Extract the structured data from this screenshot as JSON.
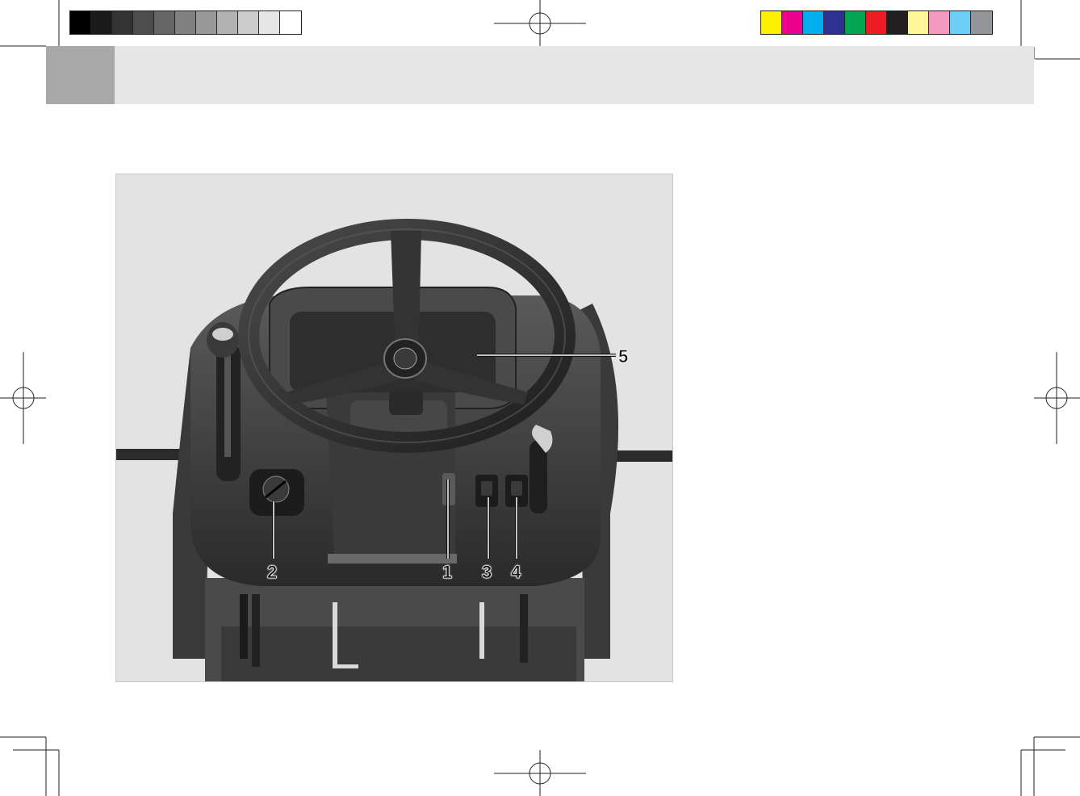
{
  "color_bars": {
    "grayscale": [
      "#000000",
      "#1a1a1a",
      "#333333",
      "#4d4d4d",
      "#666666",
      "#808080",
      "#999999",
      "#b3b3b3",
      "#cccccc",
      "#e6e6e6",
      "#ffffff"
    ],
    "process": [
      "#fff200",
      "#ec008c",
      "#00aeef",
      "#2e3192",
      "#00a651",
      "#ed1c24",
      "#231f20",
      "#fff799",
      "#f49ac1",
      "#6dcff6",
      "#939598"
    ]
  },
  "header": {
    "band_color": "#e6e6e6",
    "tab_color": "#a8a8a8"
  },
  "figure": {
    "callouts": [
      {
        "id": "1",
        "label": "1"
      },
      {
        "id": "2",
        "label": "2"
      },
      {
        "id": "3",
        "label": "3"
      },
      {
        "id": "4",
        "label": "4"
      },
      {
        "id": "5",
        "label": "5"
      }
    ],
    "icons": [
      "steering-wheel-icon",
      "ignition-switch-icon",
      "gear-lever-icon",
      "throttle-lever-icon",
      "rocker-switch-icon"
    ]
  }
}
